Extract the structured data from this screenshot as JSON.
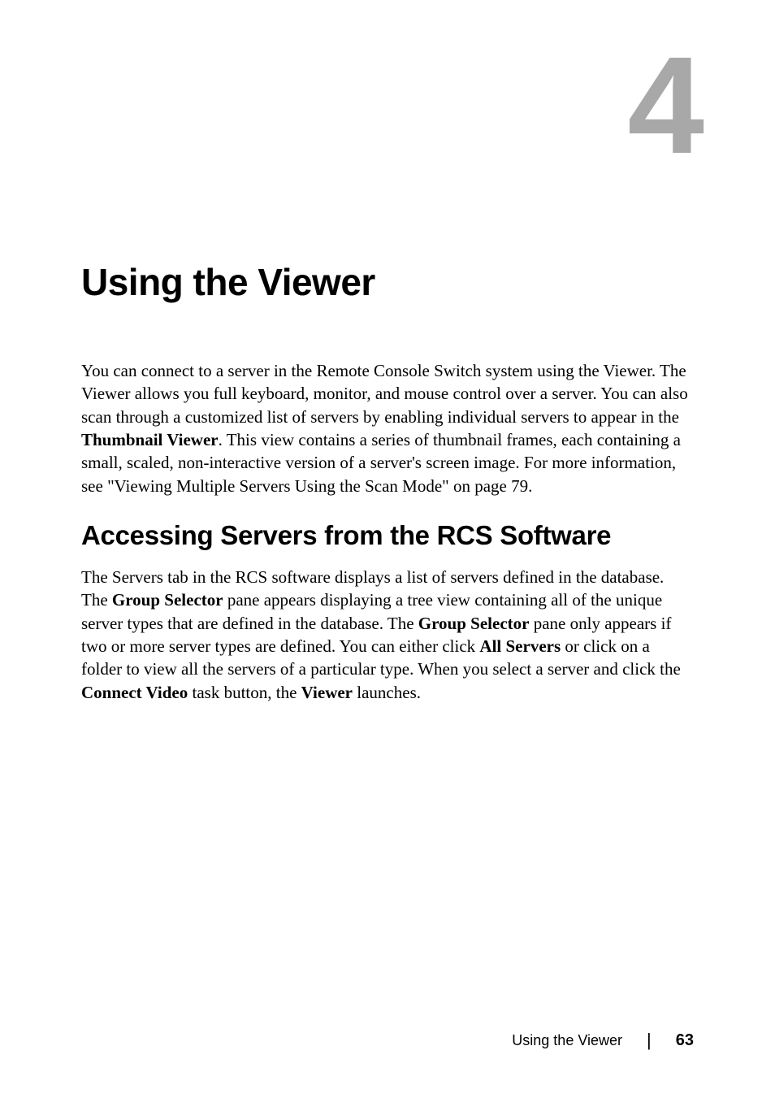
{
  "chapter": {
    "number": "4",
    "title": "Using the Viewer"
  },
  "intro": {
    "part1": "You can connect to a server in the Remote Console Switch system using the Viewer. The Viewer allows you full keyboard, monitor, and mouse control over a server. You can also scan through a customized list of servers by enabling individual servers to appear in the ",
    "bold1": "Thumbnail Viewer",
    "part2": ". This view contains a series of thumbnail frames, each containing a small, scaled, non-interactive version of a server's screen image. For more information, see \"Viewing Multiple Servers Using the Scan Mode\" on page 79."
  },
  "section": {
    "heading": "Accessing Servers from the RCS Software",
    "para": {
      "p1": "The Servers tab in the RCS software displays a list of servers defined in the database. The ",
      "b1": "Group Selector",
      "p2": " pane appears displaying a tree view containing all of the unique server types that are defined in the database. The ",
      "b2": "Group Selector",
      "p3": " pane only appears if two or more server types are defined. You can either click ",
      "b3": "All Servers",
      "p4": " or click on a folder to view all the servers of a particular type. When you select a server and click the ",
      "b4": "Connect Video",
      "p5": " task button, the ",
      "b5": "Viewer",
      "p6": " launches."
    }
  },
  "footer": {
    "title": "Using the Viewer",
    "divider": "|",
    "page": "63"
  }
}
